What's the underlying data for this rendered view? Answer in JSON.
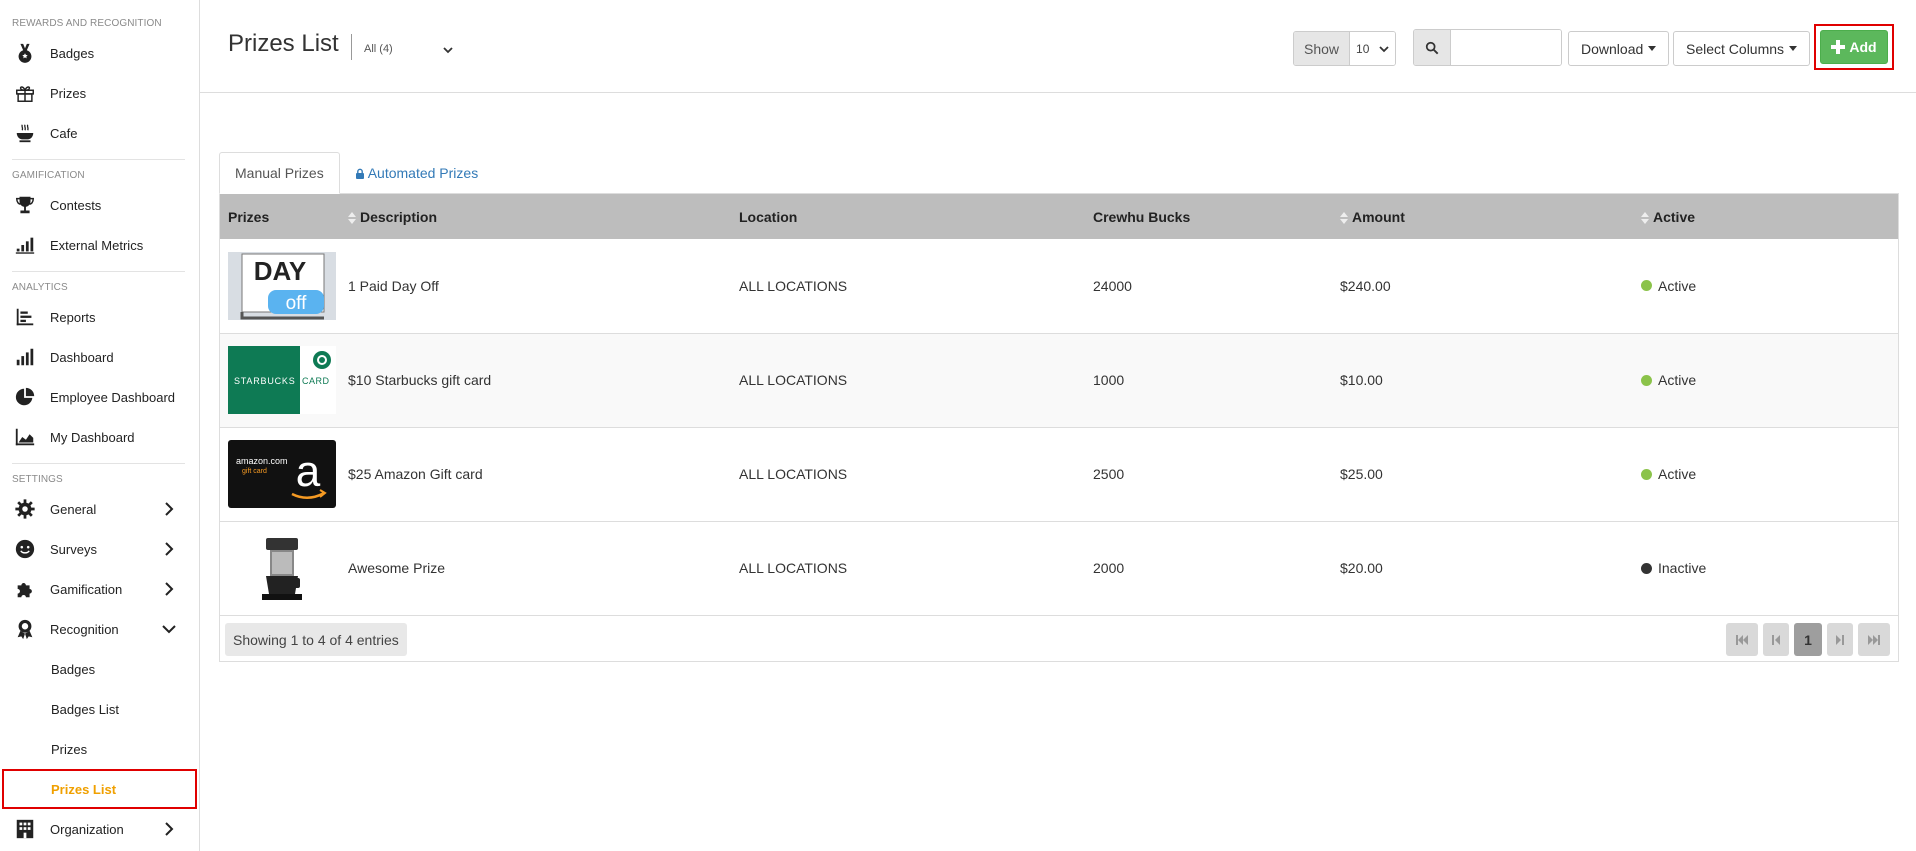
{
  "sidebar": {
    "sections": {
      "rewards": "REWARDS AND RECOGNITION",
      "gamification": "GAMIFICATION",
      "analytics": "ANALYTICS",
      "settings": "SETTINGS"
    },
    "items": {
      "badges": "Badges",
      "prizes": "Prizes",
      "cafe": "Cafe",
      "contests": "Contests",
      "external_metrics": "External Metrics",
      "reports": "Reports",
      "dashboard": "Dashboard",
      "employee_dashboard": "Employee Dashboard",
      "my_dashboard": "My Dashboard",
      "general": "General",
      "surveys": "Surveys",
      "gamification": "Gamification",
      "recognition": "Recognition",
      "organization": "Organization"
    },
    "recognition_sub": {
      "badges": "Badges",
      "badges_list": "Badges List",
      "prizes": "Prizes",
      "prizes_list": "Prizes List"
    },
    "active_color": "#f0a000"
  },
  "header": {
    "title": "Prizes List",
    "filter_value": "All (4)",
    "show_label": "Show",
    "show_value": "10",
    "search_placeholder": "",
    "download_label": "Download",
    "select_columns_label": "Select Columns",
    "add_label": "Add"
  },
  "tabs": {
    "manual": "Manual Prizes",
    "automated": "Automated Prizes"
  },
  "table": {
    "columns": {
      "prizes": "Prizes",
      "description": "Description",
      "location": "Location",
      "bucks": "Crewhu Bucks",
      "amount": "Amount",
      "active": "Active"
    },
    "rows": [
      {
        "description": "1 Paid Day Off",
        "location": "ALL LOCATIONS",
        "bucks": "24000",
        "amount": "$240.00",
        "status": "Active"
      },
      {
        "description": "$10 Starbucks gift card",
        "location": "ALL LOCATIONS",
        "bucks": "1000",
        "amount": "$10.00",
        "status": "Active"
      },
      {
        "description": "$25 Amazon Gift card",
        "location": "ALL LOCATIONS",
        "bucks": "2500",
        "amount": "$25.00",
        "status": "Active"
      },
      {
        "description": "Awesome Prize",
        "location": "ALL LOCATIONS",
        "bucks": "2000",
        "amount": "$20.00",
        "status": "Inactive"
      }
    ],
    "thumbs": {
      "dayoff_top": "DAY",
      "dayoff_bottom": "off",
      "starbucks": "STARBUCKS",
      "starbucks_card": "CARD",
      "amazon_brand": "amazon.com",
      "amazon_sub": "gift card",
      "amazon_letter": "a"
    },
    "footer_info": "Showing 1 to 4 of 4 entries",
    "current_page": "1"
  },
  "colors": {
    "active_dot": "#8bc34a",
    "inactive_dot": "#333333",
    "add_button": "#5cb85c",
    "header_bg": "#bdbdbd",
    "highlight_border": "#e00000"
  }
}
